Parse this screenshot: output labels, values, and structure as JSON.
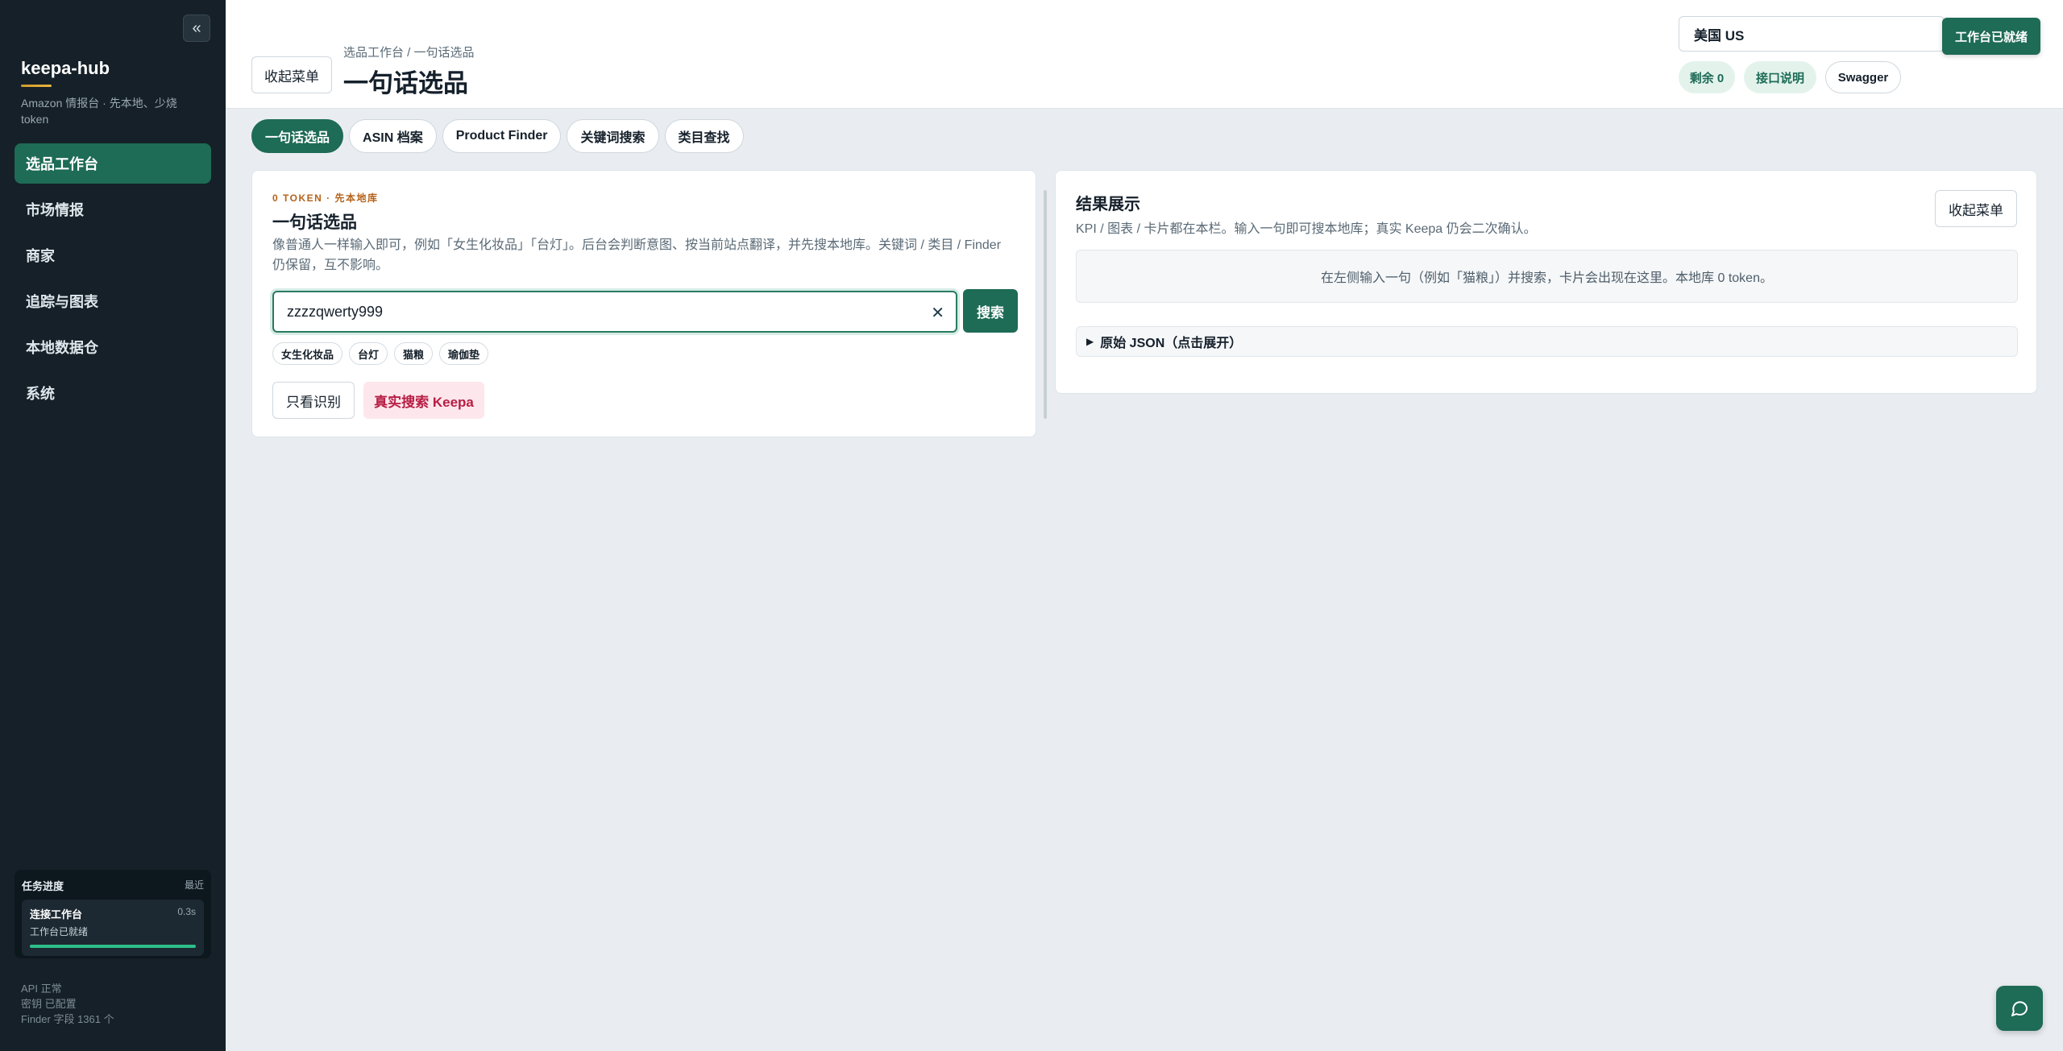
{
  "sidebar": {
    "collapse_icon": "«",
    "brand": "keepa-hub",
    "subtitle": "Amazon 情报台 · 先本地、少烧 token",
    "nav": [
      {
        "label": "选品工作台",
        "active": true
      },
      {
        "label": "市场情报"
      },
      {
        "label": "商家"
      },
      {
        "label": "追踪与图表"
      },
      {
        "label": "本地数据仓"
      },
      {
        "label": "系统"
      }
    ],
    "tasks": {
      "title": "任务进度",
      "recent": "最近",
      "item_name": "连接工作台",
      "item_time": "0.3s",
      "item_status": "工作台已就绪",
      "progress": 1.0
    },
    "status": {
      "api": "API 正常",
      "key": "密钥 已配置",
      "finder": "Finder 字段 1361 个"
    }
  },
  "topbar": {
    "collapse_menu": "收起菜单",
    "breadcrumb": "选品工作台 / 一句话选品",
    "title": "一句话选品",
    "market": "美国 US",
    "ready_badge": "工作台已就绪",
    "remain": "剩余 0",
    "api_doc": "接口说明",
    "swagger": "Swagger"
  },
  "tabs": [
    "一句话选品",
    "ASIN 档案",
    "Product Finder",
    "关键词搜索",
    "类目查找"
  ],
  "left_card": {
    "kicker": "0 TOKEN · 先本地库",
    "title": "一句话选品",
    "desc": "像普通人一样输入即可，例如「女生化妆品」「台灯」。后台会判断意图、按当前站点翻译，并先搜本地库。关键词 / 类目 / Finder 仍保留，互不影响。",
    "search_value": "zzzzqwerty999",
    "clear_icon": "✕",
    "search_btn": "搜索",
    "chips": [
      "女生化妆品",
      "台灯",
      "猫粮",
      "瑜伽垫"
    ],
    "recognize_btn": "只看识别",
    "keepa_btn": "真实搜索 Keepa"
  },
  "right_card": {
    "title": "结果展示",
    "desc": "KPI / 图表 / 卡片都在本栏。输入一句即可搜本地库；真实 Keepa 仍会二次确认。",
    "collapse_menu": "收起菜单",
    "empty": "在左侧输入一句（例如「猫粮」）并搜索，卡片会出现在这里。本地库 0 token。",
    "json_label": "原始 JSON（点击展开）",
    "json_icon": "▶"
  },
  "colors": {
    "accent": "#1e6b56",
    "sidebar_bg": "#152028",
    "kicker": "#b5621a",
    "danger_text": "#b81d44"
  }
}
